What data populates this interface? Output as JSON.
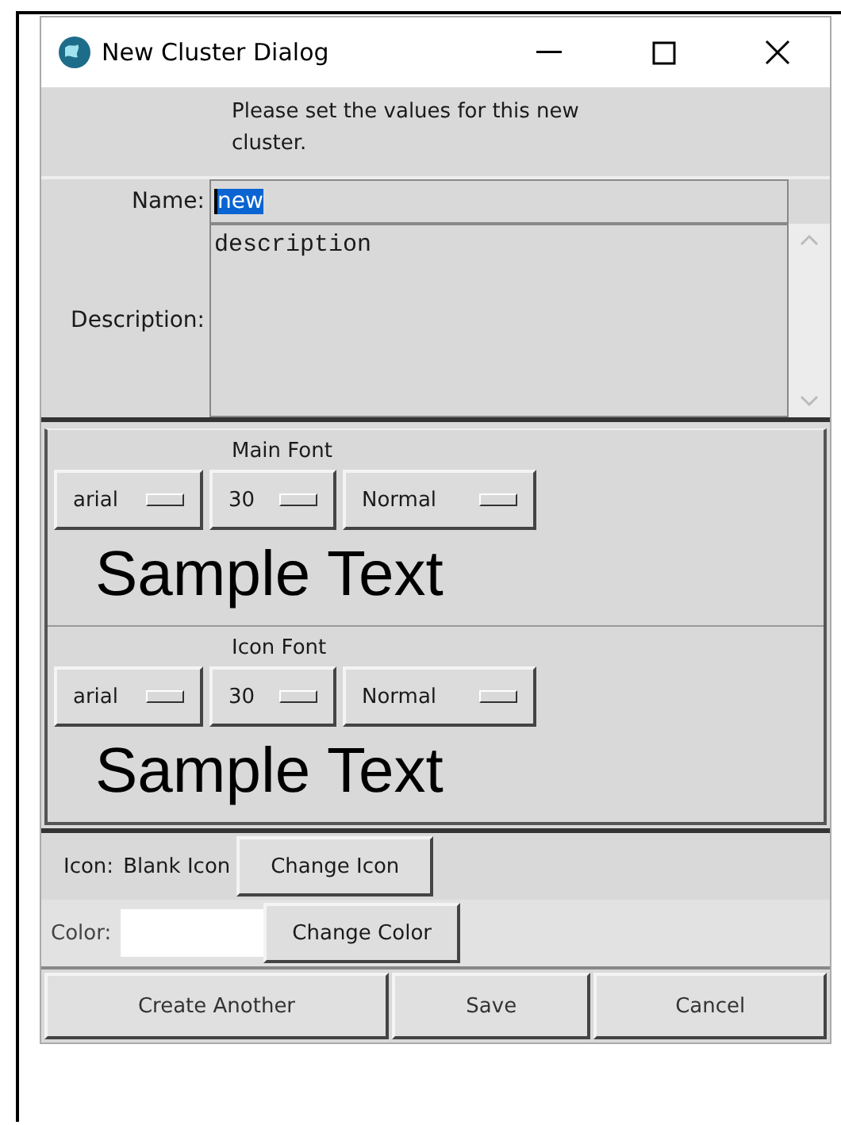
{
  "window": {
    "title": "New Cluster Dialog"
  },
  "instructions": "Please set the values for this new cluster.",
  "name": {
    "label": "Name:",
    "value": "new",
    "text_selected": true
  },
  "description": {
    "label": "Description:",
    "value": "description"
  },
  "font_sections": [
    {
      "title": "Main Font",
      "menus": [
        "arial",
        "30",
        "Normal"
      ],
      "sample": "Sample Text"
    },
    {
      "title": "Icon Font",
      "menus": [
        "arial",
        "30",
        "Normal"
      ],
      "sample": "Sample Text"
    }
  ],
  "icon": {
    "label": "Icon:",
    "value": "Blank Icon",
    "button": "Change Icon"
  },
  "color": {
    "label": "Color:",
    "color": "#ffffff",
    "button": "Change Color"
  },
  "buttons": [
    "Create Another",
    "Save",
    "Cancel"
  ]
}
